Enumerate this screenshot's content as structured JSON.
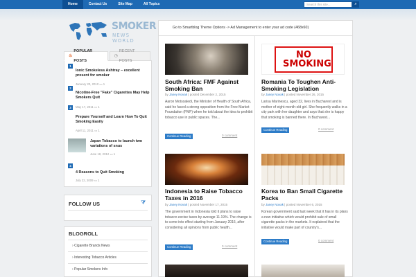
{
  "nav": {
    "items": [
      "Home",
      "Contact Us",
      "Site Map",
      "All Topics"
    ],
    "search_placeholder": "Search this site..."
  },
  "logo": {
    "line1": "SMOKER",
    "line2": "NEWS WORLD"
  },
  "ad_text": "Go to Smartblog Theme Options -> Ad Management to enter your ad code (468x60)",
  "popular": {
    "tab_popular": "POPULAR POSTS",
    "tab_recent": "RECENT POSTS",
    "items": [
      {
        "num": "1",
        "title": "Ionic Smokeless Ashtray – excellent present for smoker",
        "date": "January 20, 2010"
      },
      {
        "num": "2",
        "title": "Nicotine-Free \"Fake\" Cigarettes May Help Smokers Quit",
        "date": "May 17, 2011"
      },
      {
        "num": "3",
        "title": "Prepare Yourself and Learn How To Quit Smoking Easily",
        "date": "April 11, 2011"
      },
      {
        "num": "",
        "title": "Japan Tobacco to launch two variations of snus",
        "date": "June 18, 2012"
      },
      {
        "num": "4",
        "title": "4 Reasons to Quit Smoking",
        "date": "July 22, 2009"
      }
    ],
    "comment_counts": [
      "1",
      "1",
      "1",
      "1",
      "1"
    ]
  },
  "follow": {
    "title": "FOLLOW US"
  },
  "blogroll": {
    "title": "BLOGROLL",
    "links": [
      "Cigarette Brands News",
      "Interesting Tobacco Articles",
      "Popular Smokers Info"
    ]
  },
  "posts": [
    {
      "title": "South Africa: FMF Against Smoking Ban",
      "author": "Janey Novak",
      "date": "December 2, 2015",
      "excerpt": "Aaron Motsoaledi, the Minister of Health of South Africa, said he faced a strong opposition from the Free Market Foundation (FMF) when he told about the idea to prohibit tobacco use in public spaces. The...",
      "more": "Continue Reading",
      "comments": "0 comment"
    },
    {
      "title": "Romania To Toughen Anti-Smoking Legislation",
      "author": "Janey Novak",
      "date": "November 26, 2015",
      "excerpt": "Larisa Marinescu, aged 32, lives in Bucharest and is mother of eight-month-old girl. She frequently walks in a city park with her daughter and says that she is happy that smoking is banned there. In Bucharest...",
      "more": "Continue Reading",
      "comments": "0 comment",
      "image_text": "NO SMOKING"
    },
    {
      "title": "Indonesia to Raise Tobacco Taxes in 2016",
      "author": "Janey Novak",
      "date": "November 17, 2015",
      "excerpt": "The government in Indonesia told it plans to raise tobacco excise taxes by average 11.19%. The change is to come into effect starting from January 2016, after considering all opinions from public health...",
      "more": "Continue Reading",
      "comments": "0 comment"
    },
    {
      "title": "Korea to Ban Small Cigarette Packs",
      "author": "Janey Novak",
      "date": "November 6, 2015",
      "excerpt": "Korean government said last week that it has in its plans a new initiative which would prohibit sale of small cigarette packs in the markets. It explained that the initiative would make part of country's...",
      "more": "Continue Reading",
      "comments": "0 comment"
    }
  ],
  "byline_by": "by",
  "byline_posted": "posted"
}
